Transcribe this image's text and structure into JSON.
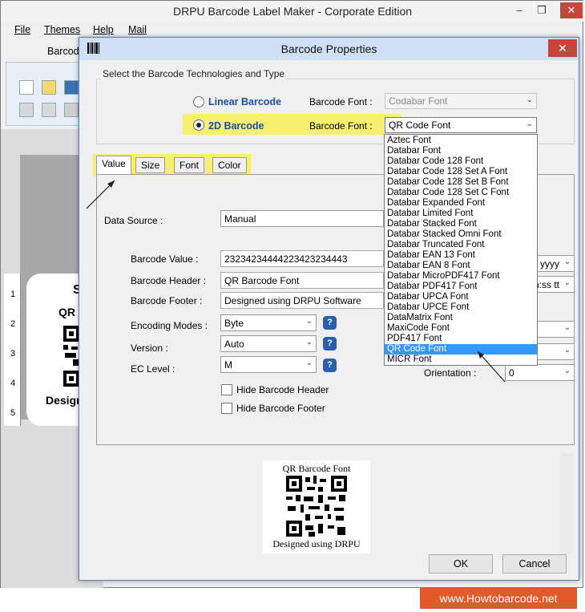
{
  "window": {
    "title": "DRPU Barcode Label Maker - Corporate Edition",
    "min": "–",
    "max": "❐",
    "close": "✕"
  },
  "menu": {
    "file": "File",
    "themes": "Themes",
    "help": "Help",
    "mail": "Mail"
  },
  "ribbon": {
    "tab_label": "Barcode"
  },
  "canvas": {
    "label_initial": "S",
    "label_qr": "QR",
    "label_design": "Design",
    "ruler": [
      "1",
      "2",
      "3",
      "4",
      "5"
    ]
  },
  "dialog": {
    "title": "Barcode Properties",
    "close": "✕",
    "tech_group_label": "Select the Barcode Technologies and Type",
    "linear_label": "Linear Barcode",
    "twod_label": "2D Barcode",
    "font_label": "Barcode Font :",
    "linear_font_value": "Codabar Font",
    "twod_font_value": "QR Code Font",
    "tabs": [
      "Value",
      "Size",
      "Font",
      "Color"
    ],
    "fields": {
      "data_source_label": "Data Source :",
      "data_source_value": "Manual",
      "barcode_value_label": "Barcode Value :",
      "barcode_value": "23234234444223423234443",
      "header_label": "Barcode Header :",
      "header_value": "QR Barcode Font",
      "footer_label": "Barcode Footer :",
      "footer_value": "Designed using DRPU Software",
      "encoding_label": "Encoding Modes :",
      "encoding_value": "Byte",
      "version_label": "Version :",
      "version_value": "Auto",
      "ec_label": "EC Level :",
      "ec_value": "M",
      "hide_header": "Hide Barcode Header",
      "hide_footer": "Hide Barcode Footer",
      "date_format_partial": "yyyy",
      "time_format_partial": "n:ss tt",
      "orientation_label": "Orientation :",
      "orientation_value": "0",
      "help_glyph": "?"
    },
    "font_options": [
      "Aztec Font",
      "Databar Font",
      "Databar Code 128 Font",
      "Databar Code 128 Set A Font",
      "Databar Code 128 Set B Font",
      "Databar Code 128 Set C Font",
      "Databar Expanded Font",
      "Databar Limited Font",
      "Databar Stacked Font",
      "Databar Stacked Omni Font",
      "Databar Truncated Font",
      "Databar EAN 13 Font",
      "Databar EAN 8 Font",
      "Databar MicroPDF417 Font",
      "Databar PDF417 Font",
      "Databar UPCA Font",
      "Databar UPCE Font",
      "DataMatrix Font",
      "MaxiCode Font",
      "PDF417 Font",
      "QR Code Font",
      "MICR Font"
    ],
    "selected_font_index": 20,
    "preview": {
      "header": "QR Barcode Font",
      "footer": "Designed using DRPU"
    },
    "ok": "OK",
    "cancel": "Cancel"
  },
  "watermark": "www.Howtobarcode.net",
  "colors": {
    "highlight": "#f6ef73",
    "selection": "#3399ff",
    "accent_blue": "#1c4fa0",
    "watermark_bg": "#e2592a"
  }
}
